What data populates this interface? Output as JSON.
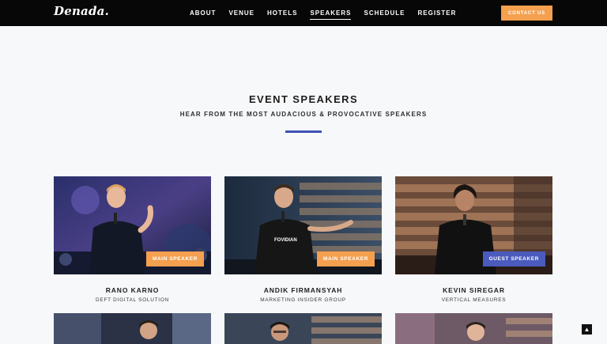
{
  "brand": {
    "logo": "Denada."
  },
  "nav": {
    "items": [
      {
        "label": "ABOUT"
      },
      {
        "label": "VENUE"
      },
      {
        "label": "HOTELS"
      },
      {
        "label": "SPEAKERS",
        "active": true
      },
      {
        "label": "SCHEDULE"
      },
      {
        "label": "REGISTER"
      }
    ],
    "contact_label": "CONTACT US"
  },
  "section": {
    "title": "EVENT SPEAKERS",
    "subtitle": "HEAR FROM THE MOST AUDACIOUS & PROVOCATIVE SPEAKERS"
  },
  "speakers": [
    {
      "name": "RANO KARNO",
      "company": "DEFT DIGITAL SOLUTION",
      "badge": "MAIN SPEAKER"
    },
    {
      "name": "ANDIK FIRMANSYAH",
      "company": "MARKETING INSIDER GROUP",
      "badge": "MAIN SPEAKER"
    },
    {
      "name": "KEVIN SIREGAR",
      "company": "VERTICAL MEASURES",
      "badge": "GUEST SPEAKER"
    }
  ],
  "colors": {
    "accent_orange": "#f4a04f",
    "accent_blue": "#3f51b5",
    "guest_badge": "#4a5bbd",
    "navbar": "#070707"
  },
  "icons": {
    "scroll_top": "chevron-up-icon"
  }
}
